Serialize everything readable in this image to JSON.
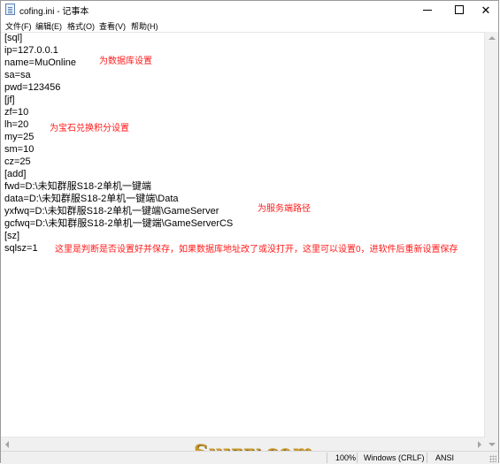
{
  "window": {
    "title": "cofing.ini - 记事本",
    "minimize_icon": "minimize-icon",
    "maximize_icon": "maximize-icon",
    "close_icon": "close-icon",
    "close_glyph": "✕"
  },
  "menu": {
    "items": [
      "文件(F)",
      "编辑(E)",
      "格式(O)",
      "查看(V)",
      "帮助(H)"
    ]
  },
  "content": {
    "lines": [
      "[sql]",
      "ip=127.0.0.1",
      "name=MuOnline",
      "sa=sa",
      "pwd=123456",
      "[jf]",
      "zf=10",
      "lh=20",
      "my=25",
      "sm=10",
      "cz=25",
      "[add]",
      "fwd=D:\\未知群服S18-2单机一键端",
      "data=D:\\未知群服S18-2单机一键端\\Data",
      "yxfwq=D:\\未知群服S18-2单机一键端\\GameServer",
      "gcfwq=D:\\未知群服S18-2单机一键端\\GameServerCS",
      "[sz]",
      "sqlsz=1"
    ],
    "annotations": {
      "database": "为数据库设置",
      "gem_points": "为宝石兑换积分设置",
      "server_path": "为服务端路径",
      "save_flag": "这里是判断是否设置好并保存，如果数据库地址改了或没打开，这里可以设置0，进软件后重新设置保存"
    },
    "annotation_color": "#ff1a1a"
  },
  "status": {
    "zoom": "100%",
    "line_ending": "Windows (CRLF)",
    "encoding": "ANSI"
  },
  "watermark": "Suvvv.com"
}
